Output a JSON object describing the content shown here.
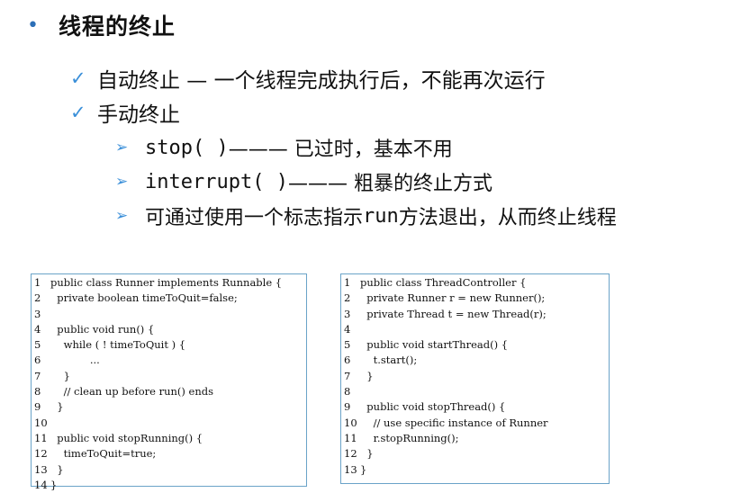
{
  "title": "线程的终止",
  "points": [
    {
      "text": "自动终止 — 一个线程完成执行后，不能再次运行"
    },
    {
      "text": "手动终止"
    }
  ],
  "subpoints": [
    {
      "code": "stop( )",
      "text": " ——— 已过时，基本不用"
    },
    {
      "code": "interrupt( )",
      "text": " ——— 粗暴的终止方式"
    },
    {
      "code": "",
      "text": "可通过使用一个标志指示 ",
      "code2": "run",
      "text2": " 方法退出，从而终止线程"
    }
  ],
  "code_left": [
    {
      "n": "1",
      "t": "public class Runner implements Runnable {"
    },
    {
      "n": "2",
      "t": "  private boolean timeToQuit=false;"
    },
    {
      "n": "3",
      "t": ""
    },
    {
      "n": "4",
      "t": "  public void run() {"
    },
    {
      "n": "5",
      "t": "    while ( ! timeToQuit ) {"
    },
    {
      "n": "6",
      "t": "            ..."
    },
    {
      "n": "7",
      "t": "    }"
    },
    {
      "n": "8",
      "t": "    // clean up before run() ends"
    },
    {
      "n": "9",
      "t": "  }"
    },
    {
      "n": "10",
      "t": ""
    },
    {
      "n": "11",
      "t": "  public void stopRunning() {"
    },
    {
      "n": "12",
      "t": "    timeToQuit=true;"
    },
    {
      "n": "13",
      "t": "  }"
    },
    {
      "n": "14",
      "t": "}"
    }
  ],
  "code_right": [
    {
      "n": "1",
      "t": "public class ThreadController {"
    },
    {
      "n": "2",
      "t": "  private Runner r = new Runner();"
    },
    {
      "n": "3",
      "t": "  private Thread t = new Thread(r);"
    },
    {
      "n": "4",
      "t": ""
    },
    {
      "n": "5",
      "t": "  public void startThread() {"
    },
    {
      "n": "6",
      "t": "    t.start();"
    },
    {
      "n": "7",
      "t": "  }"
    },
    {
      "n": "8",
      "t": ""
    },
    {
      "n": "9",
      "t": "  public void stopThread() {"
    },
    {
      "n": "10",
      "t": "    // use specific instance of Runner"
    },
    {
      "n": "11",
      "t": "    r.stopRunning();"
    },
    {
      "n": "12",
      "t": "  }"
    },
    {
      "n": "13",
      "t": "}"
    }
  ]
}
